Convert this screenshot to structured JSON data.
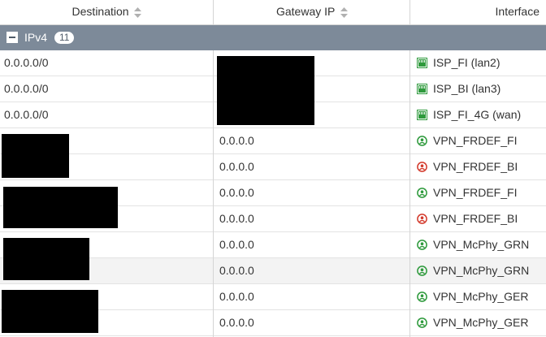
{
  "columns": {
    "destination": "Destination",
    "gateway": "Gateway IP",
    "interface": "Interface"
  },
  "group": {
    "name": "IPv4",
    "count": "11"
  },
  "rows": [
    {
      "destination": "0.0.0.0/0",
      "gateway": "",
      "interface": "ISP_FI (lan2)",
      "icon": "port-icon"
    },
    {
      "destination": "0.0.0.0/0",
      "gateway": "",
      "interface": "ISP_BI (lan3)",
      "icon": "port-icon"
    },
    {
      "destination": "0.0.0.0/0",
      "gateway": "",
      "interface": "ISP_FI_4G (wan)",
      "icon": "port-icon"
    },
    {
      "destination": "",
      "gateway": "0.0.0.0",
      "interface": "VPN_FRDEF_FI",
      "icon": "vpn-tunnel-up-icon"
    },
    {
      "destination": "",
      "gateway": "0.0.0.0",
      "interface": "VPN_FRDEF_BI",
      "icon": "vpn-tunnel-down-icon"
    },
    {
      "destination": "",
      "gateway": "0.0.0.0",
      "interface": "VPN_FRDEF_FI",
      "icon": "vpn-tunnel-up-icon"
    },
    {
      "destination": "",
      "gateway": "0.0.0.0",
      "interface": "VPN_FRDEF_BI",
      "icon": "vpn-tunnel-down-icon"
    },
    {
      "destination": "",
      "gateway": "0.0.0.0",
      "interface": "VPN_McPhy_GRN",
      "icon": "vpn-tunnel-up-icon"
    },
    {
      "destination": "",
      "gateway": "0.0.0.0",
      "interface": "VPN_McPhy_GRN",
      "icon": "vpn-tunnel-up-icon"
    },
    {
      "destination": "",
      "gateway": "0.0.0.0",
      "interface": "VPN_McPhy_GER",
      "icon": "vpn-tunnel-up-icon"
    },
    {
      "destination": "",
      "gateway": "0.0.0.0",
      "interface": "VPN_McPhy_GER",
      "icon": "vpn-tunnel-up-icon"
    }
  ],
  "colors": {
    "group_header": "#7d8a99",
    "port_green": "#2e9a3c",
    "tunnel_up": "#2e9a3c",
    "tunnel_down": "#d33a2c",
    "redaction": "#000000"
  }
}
